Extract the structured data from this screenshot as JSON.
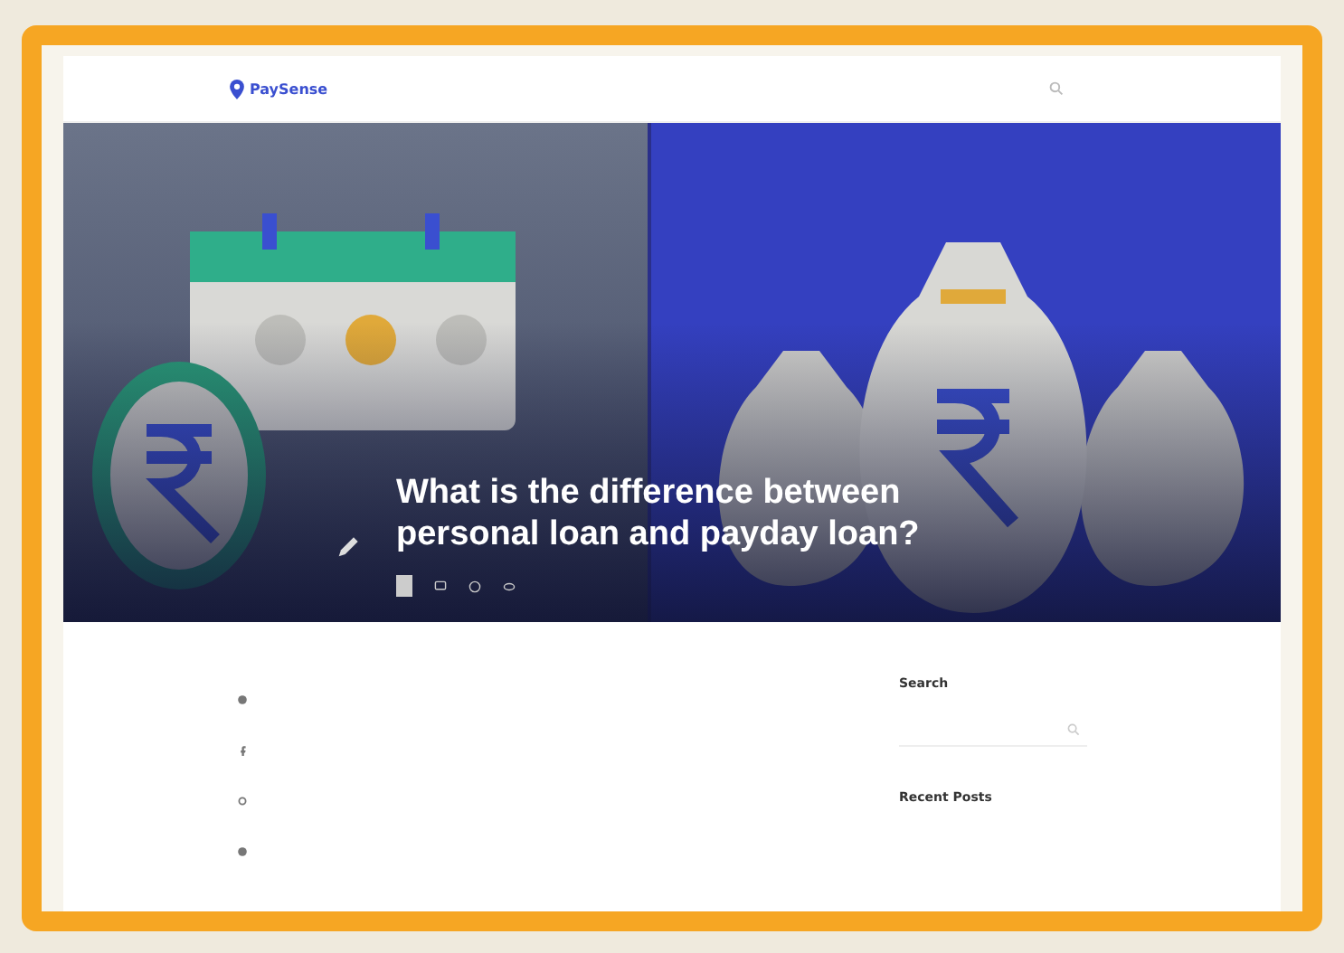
{
  "header": {
    "logo": "PaySense"
  },
  "hero": {
    "title": "What is the difference between personal loan and payday loan?"
  },
  "sidebar": {
    "widgets": [
      {
        "heading": "Search",
        "kind": "search"
      },
      {
        "heading": "Recent Posts",
        "kind": "posts"
      }
    ]
  }
}
